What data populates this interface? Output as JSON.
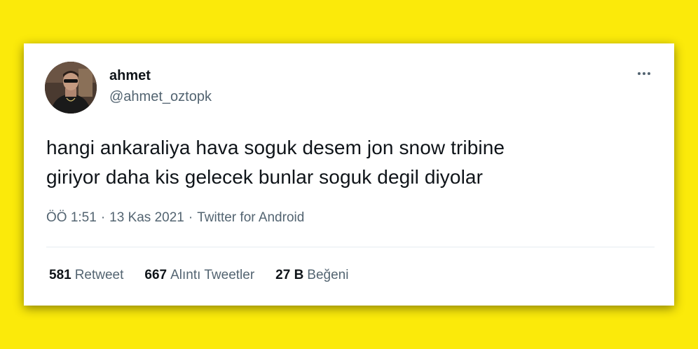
{
  "colors": {
    "background": "#fbea0a",
    "card": "#ffffff",
    "text": "#0f1419",
    "muted": "#536471"
  },
  "tweet": {
    "author_name": "ahmet",
    "author_handle": "@ahmet_oztopk",
    "more_icon": "more-horizontal-icon",
    "text_line1": "hangi ankaraliya hava soguk desem jon snow tribine",
    "text_line2": "giriyor daha kis gelecek bunlar soguk degil diyolar",
    "time": "ÖÖ 1:51",
    "date": "13 Kas 2021",
    "source": "Twitter for Android",
    "separator": "·"
  },
  "stats": {
    "retweets_count": "581",
    "retweets_label": "Retweet",
    "quotes_count": "667",
    "quotes_label": "Alıntı Tweetler",
    "likes_count": "27 B",
    "likes_label": "Beğeni"
  }
}
